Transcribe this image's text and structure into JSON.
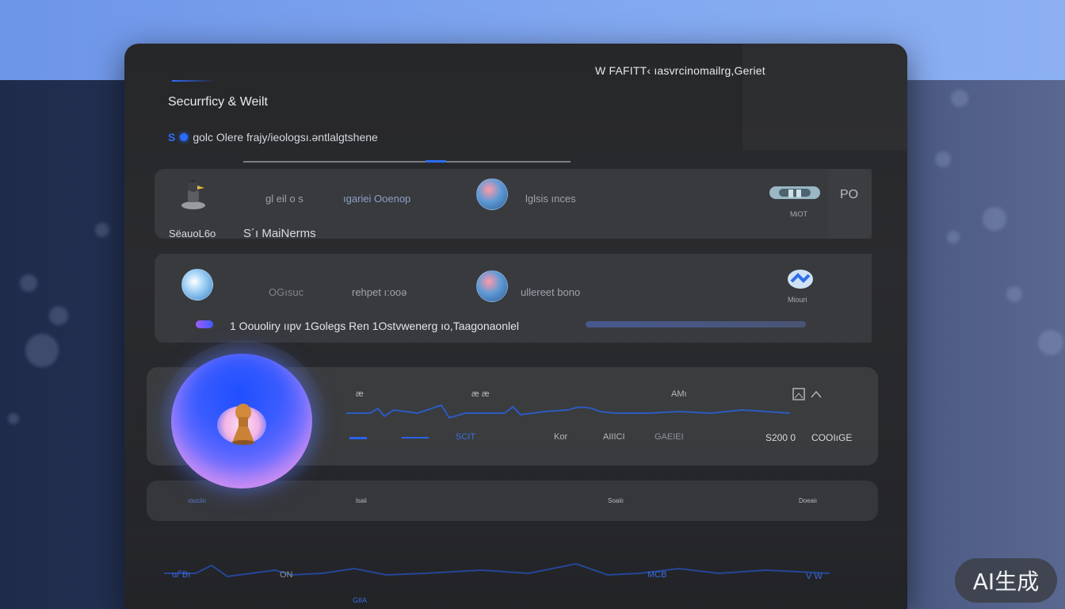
{
  "header": {
    "top_text": "W FAFITT‹ ıasvrcinomailrg,Geriet"
  },
  "page": {
    "title": "Securrficy & Weilt",
    "subtitle": "golc  Olere frajy/ieologsı.əntlalgtshene",
    "subtitle_prefix": "S"
  },
  "rows": [
    {
      "cells": [
        "gl eil o s",
        "ıgariei Ooenop",
        "lglsis ınces"
      ],
      "label_left": "SëauoL6o",
      "label_mid": "S´ı MaiNerms",
      "side_label": "MiOT",
      "side_text": "PO"
    },
    {
      "cells": [
        "OGısuc",
        "rehpet ı:ooə",
        "ullereet bono"
      ],
      "side_label": "Miouri",
      "notice": "1 Oouoliry ııpv 1Golegs Ren 1Ostvwenerg ıo,Taagonaonlel"
    }
  ],
  "card1": {
    "labels_top": [
      "æ",
      "æ æ",
      "AMı"
    ],
    "labels_bottom": [
      "SCIT",
      "Kor",
      "AIIICI",
      "GAEIEI"
    ],
    "amount": "S200 0",
    "status": "COOIıGE"
  },
  "card2": {
    "labels": [
      "ıouciiıı",
      "lsaii",
      "Soaiiı",
      "Doeaiı"
    ]
  },
  "bottom": {
    "labels": [
      "u/˚Bı",
      "ON",
      "MCB",
      "V W",
      "GIIA"
    ]
  },
  "badge": {
    "text": "AI生成"
  },
  "colors": {
    "accent": "#2d6cf5",
    "panel": "#28292c",
    "orb_top": "#1f4fff",
    "orb_bottom": "#d597ef"
  },
  "icons": [
    "robot-icon",
    "avatar-icon",
    "bell-icon",
    "cloud-icon",
    "image-icon"
  ]
}
